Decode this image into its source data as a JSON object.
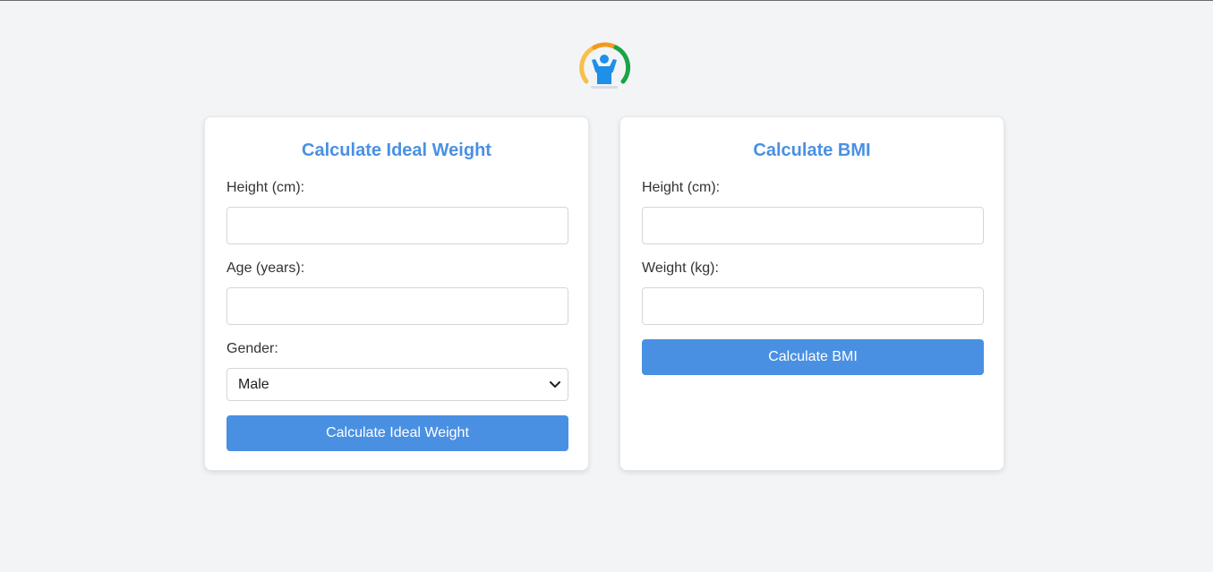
{
  "ideal_weight": {
    "title": "Calculate Ideal Weight",
    "height_label": "Height (cm):",
    "height_value": "",
    "age_label": "Age (years):",
    "age_value": "",
    "gender_label": "Gender:",
    "gender_selected": "Male",
    "button_label": "Calculate Ideal Weight"
  },
  "bmi": {
    "title": "Calculate BMI",
    "height_label": "Height (cm):",
    "height_value": "",
    "weight_label": "Weight (kg):",
    "weight_value": "",
    "button_label": "Calculate BMI"
  },
  "colors": {
    "accent": "#4a90e2",
    "page_background": "#f3f4f6",
    "logo_person": "#1e90e8",
    "logo_arc_left": "#f7c04a",
    "logo_arc_top": "#f39a1e",
    "logo_arc_right": "#1aa34a"
  },
  "icons": {
    "logo": "fitness-gauge-logo",
    "select_arrow": "chevron-down-icon"
  }
}
